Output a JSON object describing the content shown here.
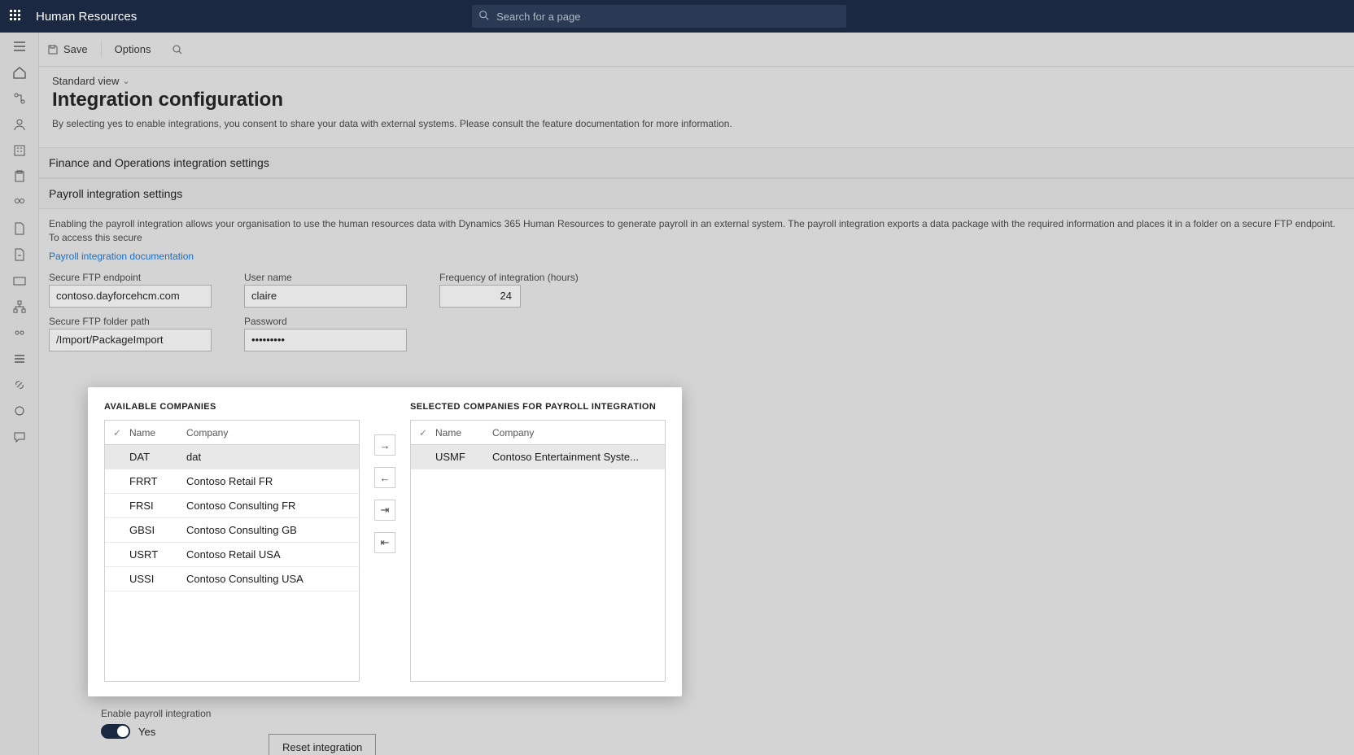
{
  "header": {
    "app_name": "Human Resources",
    "search_placeholder": "Search for a page"
  },
  "toolbar": {
    "save": "Save",
    "options": "Options"
  },
  "page": {
    "view_label": "Standard view",
    "title": "Integration configuration",
    "consent": "By selecting yes to enable integrations, you consent to share your data with external systems. Please consult the feature documentation for more information."
  },
  "sections": {
    "finops": "Finance and Operations integration settings",
    "payroll": "Payroll integration settings",
    "payroll_desc": "Enabling the payroll integration allows your organisation to use the human resources data with Dynamics 365 Human Resources to generate payroll in an external system. The payroll integration exports a data package with the required information and places it in a folder on a secure FTP endpoint. To access this secure",
    "doc_link": "Payroll integration documentation"
  },
  "fields": {
    "endpoint_label": "Secure FTP endpoint",
    "endpoint_value": "contoso.dayforcehcm.com",
    "folder_label": "Secure FTP folder path",
    "folder_value": "/Import/PackageImport",
    "user_label": "User name",
    "user_value": "claire",
    "pwd_label": "Password",
    "pwd_value": "•••••••••",
    "freq_label": "Frequency of integration (hours)",
    "freq_value": "24"
  },
  "companies": {
    "available_title": "AVAILABLE COMPANIES",
    "selected_title": "SELECTED COMPANIES FOR PAYROLL INTEGRATION",
    "col_check": "✓",
    "col_name": "Name",
    "col_company": "Company",
    "available": [
      {
        "name": "DAT",
        "company": "dat"
      },
      {
        "name": "FRRT",
        "company": "Contoso Retail FR"
      },
      {
        "name": "FRSI",
        "company": "Contoso Consulting FR"
      },
      {
        "name": "GBSI",
        "company": "Contoso Consulting GB"
      },
      {
        "name": "USRT",
        "company": "Contoso Retail USA"
      },
      {
        "name": "USSI",
        "company": "Contoso Consulting USA"
      }
    ],
    "selected": [
      {
        "name": "USMF",
        "company": "Contoso Entertainment Syste..."
      }
    ]
  },
  "toggle": {
    "label": "Enable payroll integration",
    "value_text": "Yes"
  },
  "buttons": {
    "reset": "Reset integration"
  }
}
